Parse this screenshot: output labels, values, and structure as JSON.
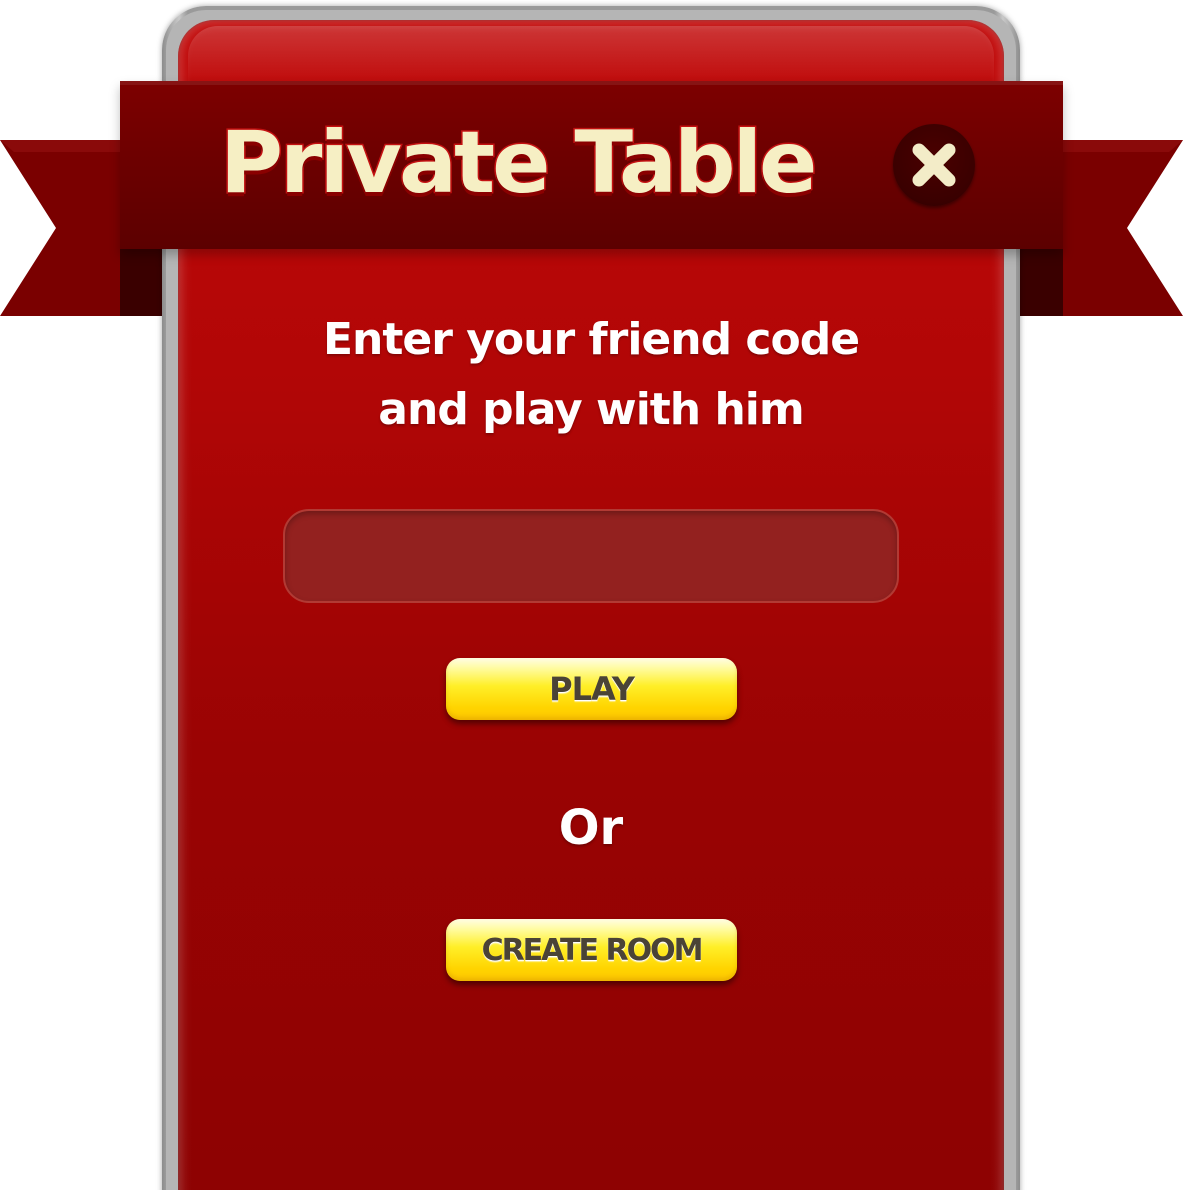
{
  "dialog": {
    "title": "Private Table",
    "close_icon": "close-icon",
    "prompt_line1": "Enter your friend code",
    "prompt_line2": "and play with him",
    "code_input": {
      "value": "",
      "placeholder": ""
    },
    "play_label": "PLAY",
    "or_label": "Or",
    "create_room_label": "CREATE ROOM"
  },
  "colors": {
    "panel_red": "#b10606",
    "ribbon_dark_red": "#6a0000",
    "title_cream": "#f6efc4",
    "button_yellow": "#ffef28",
    "input_fill": "#93211f"
  }
}
